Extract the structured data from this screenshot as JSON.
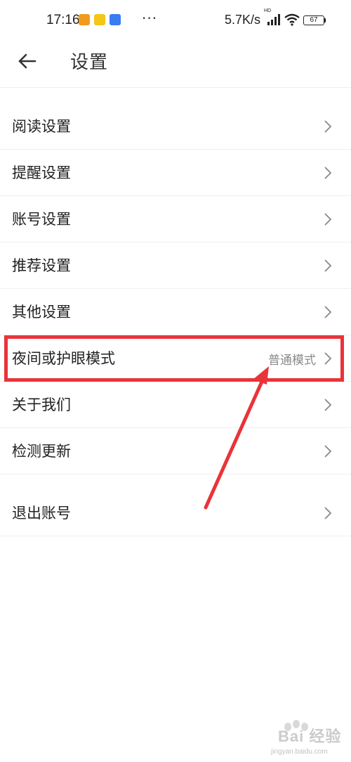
{
  "status_bar": {
    "time": "17:16",
    "more_dots": "···",
    "net_speed": "5.7K/s",
    "hd_label": "HD",
    "battery": "67",
    "app_icons": [
      "notification-app-icon-1",
      "notification-app-icon-2",
      "notification-app-icon-3"
    ],
    "app_icon_colors": [
      "#f39a1e",
      "#f5c518",
      "#3a7bf2"
    ]
  },
  "header": {
    "title": "设置",
    "back_icon": "back-arrow-icon"
  },
  "settings": {
    "items": [
      {
        "label": "阅读设置",
        "value": ""
      },
      {
        "label": "提醒设置",
        "value": ""
      },
      {
        "label": "账号设置",
        "value": ""
      },
      {
        "label": "推荐设置",
        "value": ""
      },
      {
        "label": "其他设置",
        "value": ""
      },
      {
        "label": "夜间或护眼模式",
        "value": "普通模式"
      },
      {
        "label": "关于我们",
        "value": ""
      },
      {
        "label": "检测更新",
        "value": ""
      }
    ],
    "logout": {
      "label": "退出账号"
    }
  },
  "annotation": {
    "color": "#e8343a",
    "highlight_target": "夜间或护眼模式"
  },
  "watermark": {
    "text": "Bai 经验",
    "url": "jingyan.baidu.com"
  }
}
